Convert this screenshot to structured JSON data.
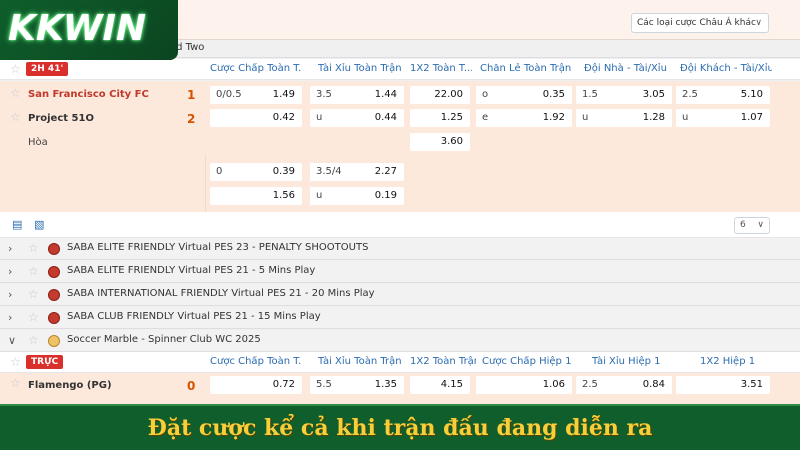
{
  "brand": {
    "logo_text": "KKWIN"
  },
  "top": {
    "odds_type": "Các loại cược Châu Á khác",
    "league_partial": "ed Two"
  },
  "match1": {
    "status_badge": "2H 41'",
    "columns": [
      "Cược Chấp Toàn T...",
      "Tài Xỉu Toàn Trận",
      "1X2 Toàn T...",
      "Chẵn Lẻ Toàn Trận",
      "Đội Nhà - Tài/Xỉu",
      "Đội Khách - Tài/Xỉu"
    ],
    "home": {
      "name": "San Francisco City FC",
      "score": "1"
    },
    "away": {
      "name": "Project 51O",
      "score": "2"
    },
    "draw_label": "Hòa",
    "rows": [
      [
        [
          "0/0.5",
          "1.49"
        ],
        [
          "3.5",
          "1.44"
        ],
        [
          "",
          "22.00"
        ],
        [
          "o",
          "0.35"
        ],
        [
          "1.5",
          "3.05"
        ],
        [
          "2.5",
          "5.10"
        ]
      ],
      [
        [
          "",
          "0.42"
        ],
        [
          "u",
          "0.44"
        ],
        [
          "",
          "1.25"
        ],
        [
          "e",
          "1.92"
        ],
        [
          "u",
          "1.28"
        ],
        [
          "u",
          "1.07"
        ]
      ],
      [
        null,
        null,
        [
          "",
          "3.60"
        ],
        null,
        null,
        null
      ]
    ],
    "extra_rows": [
      [
        [
          "0",
          "0.39"
        ],
        [
          "3.5/4",
          "2.27"
        ]
      ],
      [
        [
          "",
          "1.56"
        ],
        [
          "u",
          "0.19"
        ]
      ]
    ]
  },
  "toolbar": {
    "page_select": "6"
  },
  "leagues": [
    {
      "name": "SABA ELITE FRIENDLY Virtual PES 23 - PENALTY SHOOTOUTS",
      "icon": "team-flag-icon"
    },
    {
      "name": "SABA ELITE FRIENDLY Virtual PES 21 - 5 Mins Play",
      "icon": "team-flag-icon"
    },
    {
      "name": "SABA INTERNATIONAL FRIENDLY Virtual PES 21 - 20 Mins Play",
      "icon": "team-flag-icon"
    },
    {
      "name": "SABA CLUB FRIENDLY Virtual PES 21 - 15 Mins Play",
      "icon": "team-flag-icon"
    },
    {
      "name": "Soccer Marble - Spinner Club WC 2025",
      "icon": "soccer-ball-icon"
    }
  ],
  "match2": {
    "status_badge": "TRỰC",
    "columns": [
      "Cược Chấp Toàn T...",
      "Tài Xỉu Toàn Trận",
      "1X2 Toàn Trận",
      "Cược Chấp Hiệp 1",
      "Tài Xỉu Hiệp 1",
      "1X2 Hiệp 1"
    ],
    "home": {
      "name": "Flamengo (PG)",
      "score": "0"
    },
    "rows": [
      [
        [
          "",
          "0.72"
        ],
        [
          "5.5",
          "1.35"
        ],
        [
          "",
          "4.15"
        ],
        [
          "",
          "1.06"
        ],
        [
          "2.5",
          "0.84"
        ],
        [
          "",
          "3.51"
        ]
      ]
    ]
  },
  "banner": {
    "text": "Đặt cược kể cả khi trận đấu đang diễn ra"
  },
  "colors": {
    "accent_blue": "#2b6cb0",
    "live_red": "#d9302b",
    "banner_green": "#0f5e2b",
    "banner_text": "#f6d03a"
  }
}
